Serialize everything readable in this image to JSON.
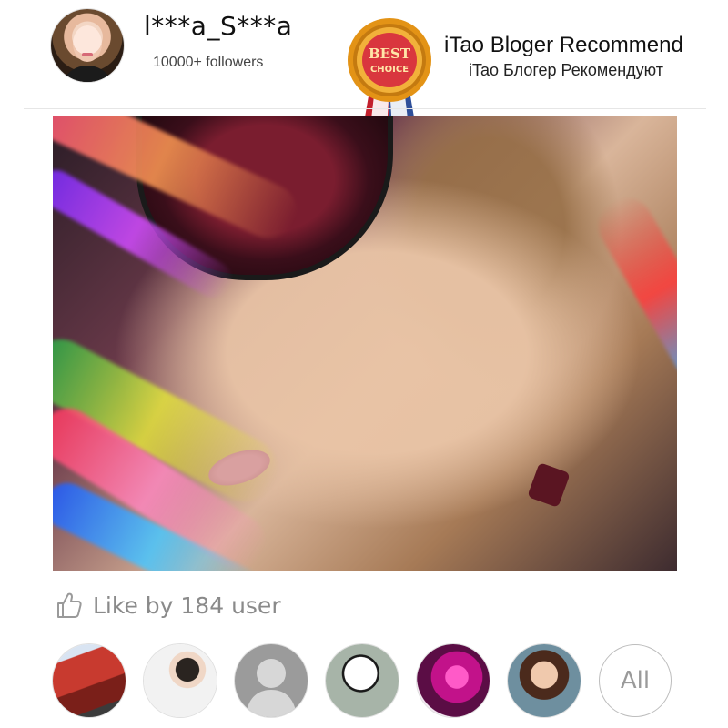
{
  "blogger": {
    "username": "l***a_S***a",
    "followers": "10000+ followers",
    "avatar_icon": "user-avatar-photo"
  },
  "badge": {
    "line1": "BEST",
    "line2": "CHOICE",
    "colors": {
      "gold": "#f1a92b",
      "ribbon_red": "#c21f2c",
      "ribbon_blue": "#2e4f9a"
    }
  },
  "recommend": {
    "title_en": "iTao Bloger Recommend",
    "title_ru": "iTao Блогер Рекомендуют"
  },
  "likes": {
    "text": "Like by 184 user",
    "icon": "thumbs-up-icon"
  },
  "likers": {
    "all_label": "All"
  },
  "colors": {
    "divider": "#e6e6e6",
    "muted_text": "#8a8a8a"
  }
}
